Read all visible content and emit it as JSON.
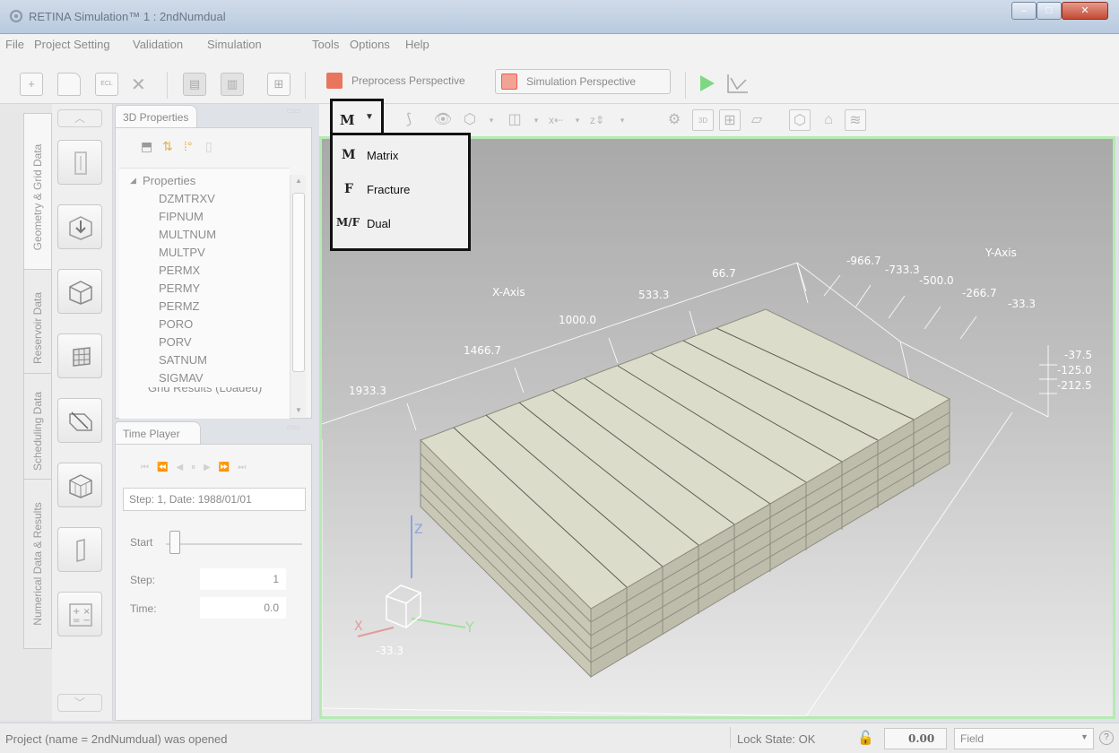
{
  "window": {
    "title": "RETINA Simulation™ 1 : 2ndNumdual",
    "controls": {
      "minimize": "–",
      "maximize": "□",
      "close": "✕"
    }
  },
  "menubar": {
    "items": [
      "File",
      "Project Setting",
      "Validation",
      "Simulation",
      "Tools",
      "Options",
      "Help"
    ]
  },
  "toolbar": {
    "preprocess_label": "Preprocess Perspective",
    "simulation_label": "Simulation Perspective",
    "icons": [
      "new-project-icon",
      "new-file-icon",
      "ecl-file-icon",
      "delete-icon",
      "save-icon",
      "save-as-icon",
      "tree-icon",
      "run-icon",
      "plot-icon"
    ]
  },
  "vertical_tabs": [
    "Geometry & Grid Data",
    "Reservoir Data",
    "Scheduling Data",
    "Numerical Data & Results"
  ],
  "properties_panel": {
    "tab_label": "3D Properties",
    "group_label": "Properties",
    "items": [
      "DZMTRXV",
      "FIPNUM",
      "MULTNUM",
      "MULTPV",
      "PERMX",
      "PERMY",
      "PERMZ",
      "PORO",
      "PORV",
      "SATNUM",
      "SIGMAV"
    ],
    "next_group_partial": "Grid Results (Loaded)"
  },
  "time_player": {
    "tab_label": "Time Player",
    "step_date": "Step: 1, Date: 1988/01/01",
    "start_label": "Start",
    "step_label": "Step:",
    "step_value": "1",
    "time_label": "Time:",
    "time_value": "0.0"
  },
  "grid_selector": {
    "current": "M",
    "options": [
      {
        "icon": "M",
        "label": "Matrix"
      },
      {
        "icon": "F",
        "label": "Fracture"
      },
      {
        "icon": "M/F",
        "label": "Dual"
      }
    ]
  },
  "viewport": {
    "x_axis_label": "X-Axis",
    "y_axis_label": "Y-Axis",
    "x_ticks": [
      "1933.3",
      "1466.7",
      "1000.0",
      "533.3",
      "66.7"
    ],
    "y_ticks": [
      "-966.7",
      "-733.3",
      "-500.0",
      "-266.7",
      "-33.3"
    ],
    "z_ticks": [
      "-37.5",
      "-125.0",
      "-212.5"
    ],
    "orientation": {
      "x": "X",
      "y": "Y",
      "z": "Z"
    },
    "corner_value": "-33.3"
  },
  "statusbar": {
    "message": "Project (name = 2ndNumdual) was opened",
    "lock_state": "Lock State: OK",
    "value_box": "0.00",
    "unit_system": "Field"
  },
  "colors": {
    "viewport_border": "#b6eab4",
    "simulation_accent": "#e8614a",
    "run_green": "#3cc04a"
  }
}
